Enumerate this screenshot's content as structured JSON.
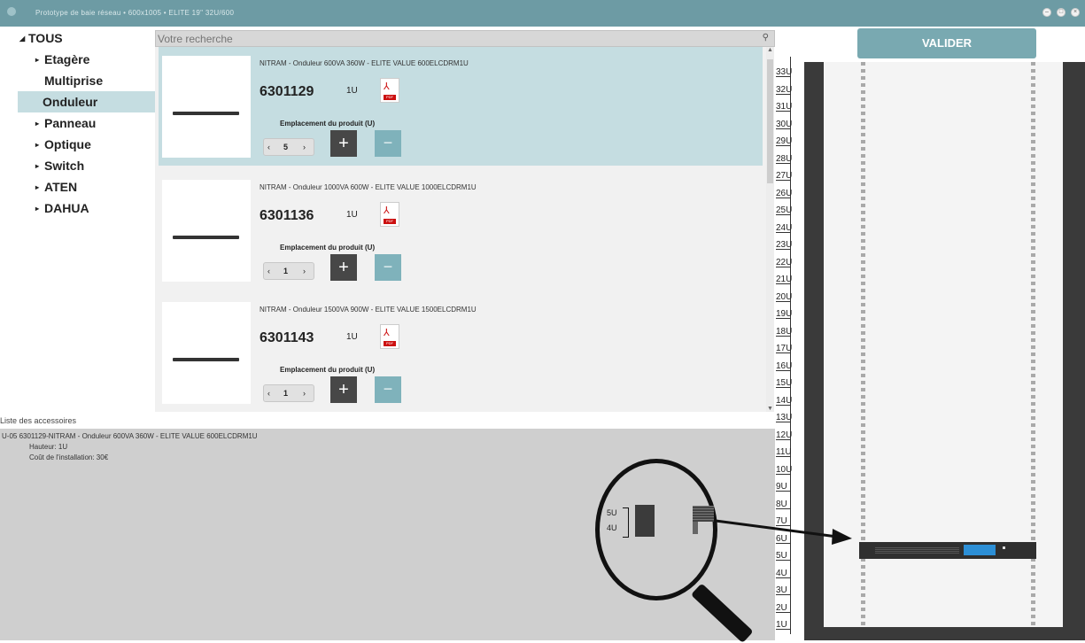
{
  "window": {
    "title": "Prototype de baie réseau • 600x1005 • ELITE 19\" 32U/600"
  },
  "tree": {
    "root": "TOUS",
    "items": [
      {
        "label": "Etagère",
        "expandable": true
      },
      {
        "label": "Multiprise",
        "expandable": false
      },
      {
        "label": "Onduleur",
        "expandable": false,
        "selected": true
      },
      {
        "label": "Panneau",
        "expandable": true
      },
      {
        "label": "Optique",
        "expandable": true
      },
      {
        "label": "Switch",
        "expandable": true
      },
      {
        "label": "ATEN",
        "expandable": true
      },
      {
        "label": "DAHUA",
        "expandable": true
      }
    ]
  },
  "search": {
    "placeholder": "Votre recherche",
    "value": ""
  },
  "products": [
    {
      "name": "NITRAM - Onduleur 600VA 360W - ELITE VALUE 600ELCDRM1U",
      "code": "6301129",
      "height": "1U",
      "placement_label": "Emplacement du produit (U)",
      "position": "5",
      "selected": true
    },
    {
      "name": "NITRAM - Onduleur 1000VA 600W - ELITE VALUE 1000ELCDRM1U",
      "code": "6301136",
      "height": "1U",
      "placement_label": "Emplacement du produit (U)",
      "position": "1",
      "selected": false
    },
    {
      "name": "NITRAM - Onduleur 1500VA 900W - ELITE VALUE 1500ELCDRM1U",
      "code": "6301143",
      "height": "1U",
      "placement_label": "Emplacement du produit (U)",
      "position": "1",
      "selected": false
    }
  ],
  "pdf_label": "PDF",
  "accessories": {
    "title": "Liste des accessoires",
    "entry": {
      "slot": "U-05",
      "description": "6301129-NITRAM - Onduleur 600VA 360W - ELITE VALUE 600ELCDRM1U",
      "height": "Hauteur: 1U",
      "cost": "Coût de l'installation: 30€"
    }
  },
  "rack": {
    "validate_label": "VALIDER",
    "units": [
      "33U",
      "32U",
      "31U",
      "30U",
      "29U",
      "28U",
      "27U",
      "26U",
      "25U",
      "24U",
      "23U",
      "22U",
      "21U",
      "20U",
      "19U",
      "18U",
      "17U",
      "16U",
      "15U",
      "14U",
      "13U",
      "12U",
      "11U",
      "10U",
      "9U",
      "8U",
      "7U",
      "6U",
      "5U",
      "4U",
      "3U",
      "2U",
      "1U"
    ],
    "zoom_labels": [
      "5U",
      "4U"
    ]
  },
  "colors": {
    "accent": "#79a9b1",
    "selection": "#c5dde1",
    "titlebar": "#6d9ba4"
  }
}
